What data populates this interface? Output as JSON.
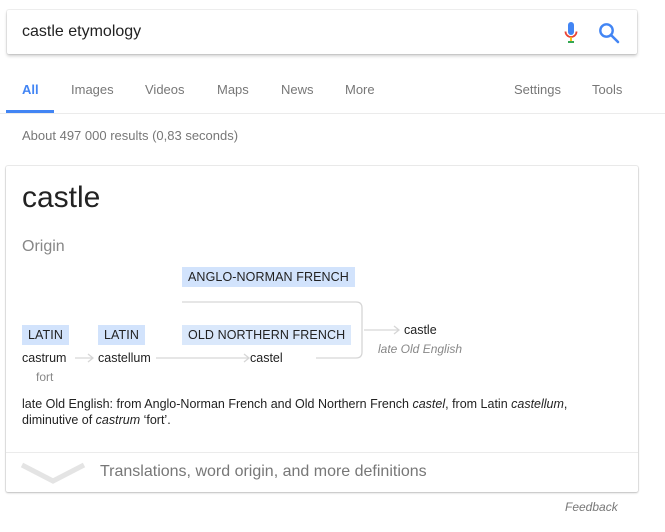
{
  "search": {
    "query": "castle etymology"
  },
  "tabs": [
    {
      "label": "All",
      "active": true
    },
    {
      "label": "Images"
    },
    {
      "label": "Videos"
    },
    {
      "label": "Maps"
    },
    {
      "label": "News"
    },
    {
      "label": "More"
    }
  ],
  "tools": {
    "settings": "Settings",
    "tools": "Tools"
  },
  "stats": "About 497 000 results (0,83 seconds)",
  "card": {
    "word": "castle",
    "origin_label": "Origin",
    "lang_anglo_norman": "ANGLO-NORMAN FRENCH",
    "lang_latin_1": "LATIN",
    "lang_latin_2": "LATIN",
    "lang_old_northern_french": "OLD NORTHERN FRENCH",
    "form_castrum": "castrum",
    "gloss_fort": "fort",
    "form_castellum": "castellum",
    "form_castel": "castel",
    "form_castle": "castle",
    "gloss_late_old_english": "late Old English",
    "definition": {
      "p1": "late Old English: from Anglo-Norman French and Old Northern French ",
      "i1": "castel",
      "p2": ", from Latin ",
      "i2": "castellum",
      "p3": ",",
      "p4": "diminutive of ",
      "i3": "castrum",
      "p5": " ‘fort’."
    },
    "more_label": "Translations, word origin, and more definitions"
  },
  "feedback": "Feedback",
  "colors": {
    "accent": "#4285f4",
    "lang_tag": "#d2e3fc"
  }
}
